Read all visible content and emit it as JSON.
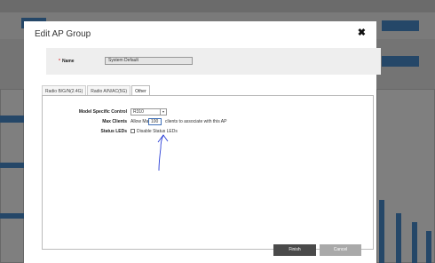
{
  "modal": {
    "title": "Edit AP Group",
    "close_symbol": "✖"
  },
  "name_field": {
    "required_mark": "*",
    "label": "Name",
    "value": "System Default"
  },
  "tabs": [
    {
      "label": "Radio B/G/N(2.4G)",
      "active": false
    },
    {
      "label": "Radio A/N/AC(5G)",
      "active": false
    },
    {
      "label": "Other",
      "active": true
    }
  ],
  "other_tab": {
    "model_label": "Model Specific Control",
    "model_value": "R310",
    "max_clients_label": "Max Clients",
    "max_clients_prefix": "Allow Max",
    "max_clients_value": "100",
    "max_clients_suffix": "clients to associate with this AP",
    "status_leds_label": "Status LEDs",
    "status_leds_checkbox_label": "Disable Status LEDs",
    "status_leds_checked": false
  },
  "buttons": {
    "finish": "Finish",
    "cancel": "Cancel"
  },
  "colors": {
    "accent_blue": "#4a8fd0",
    "finish_bg": "#4a4a4a",
    "cancel_bg": "#a9a9a9",
    "pen_annotation": "#2b3fd6"
  }
}
